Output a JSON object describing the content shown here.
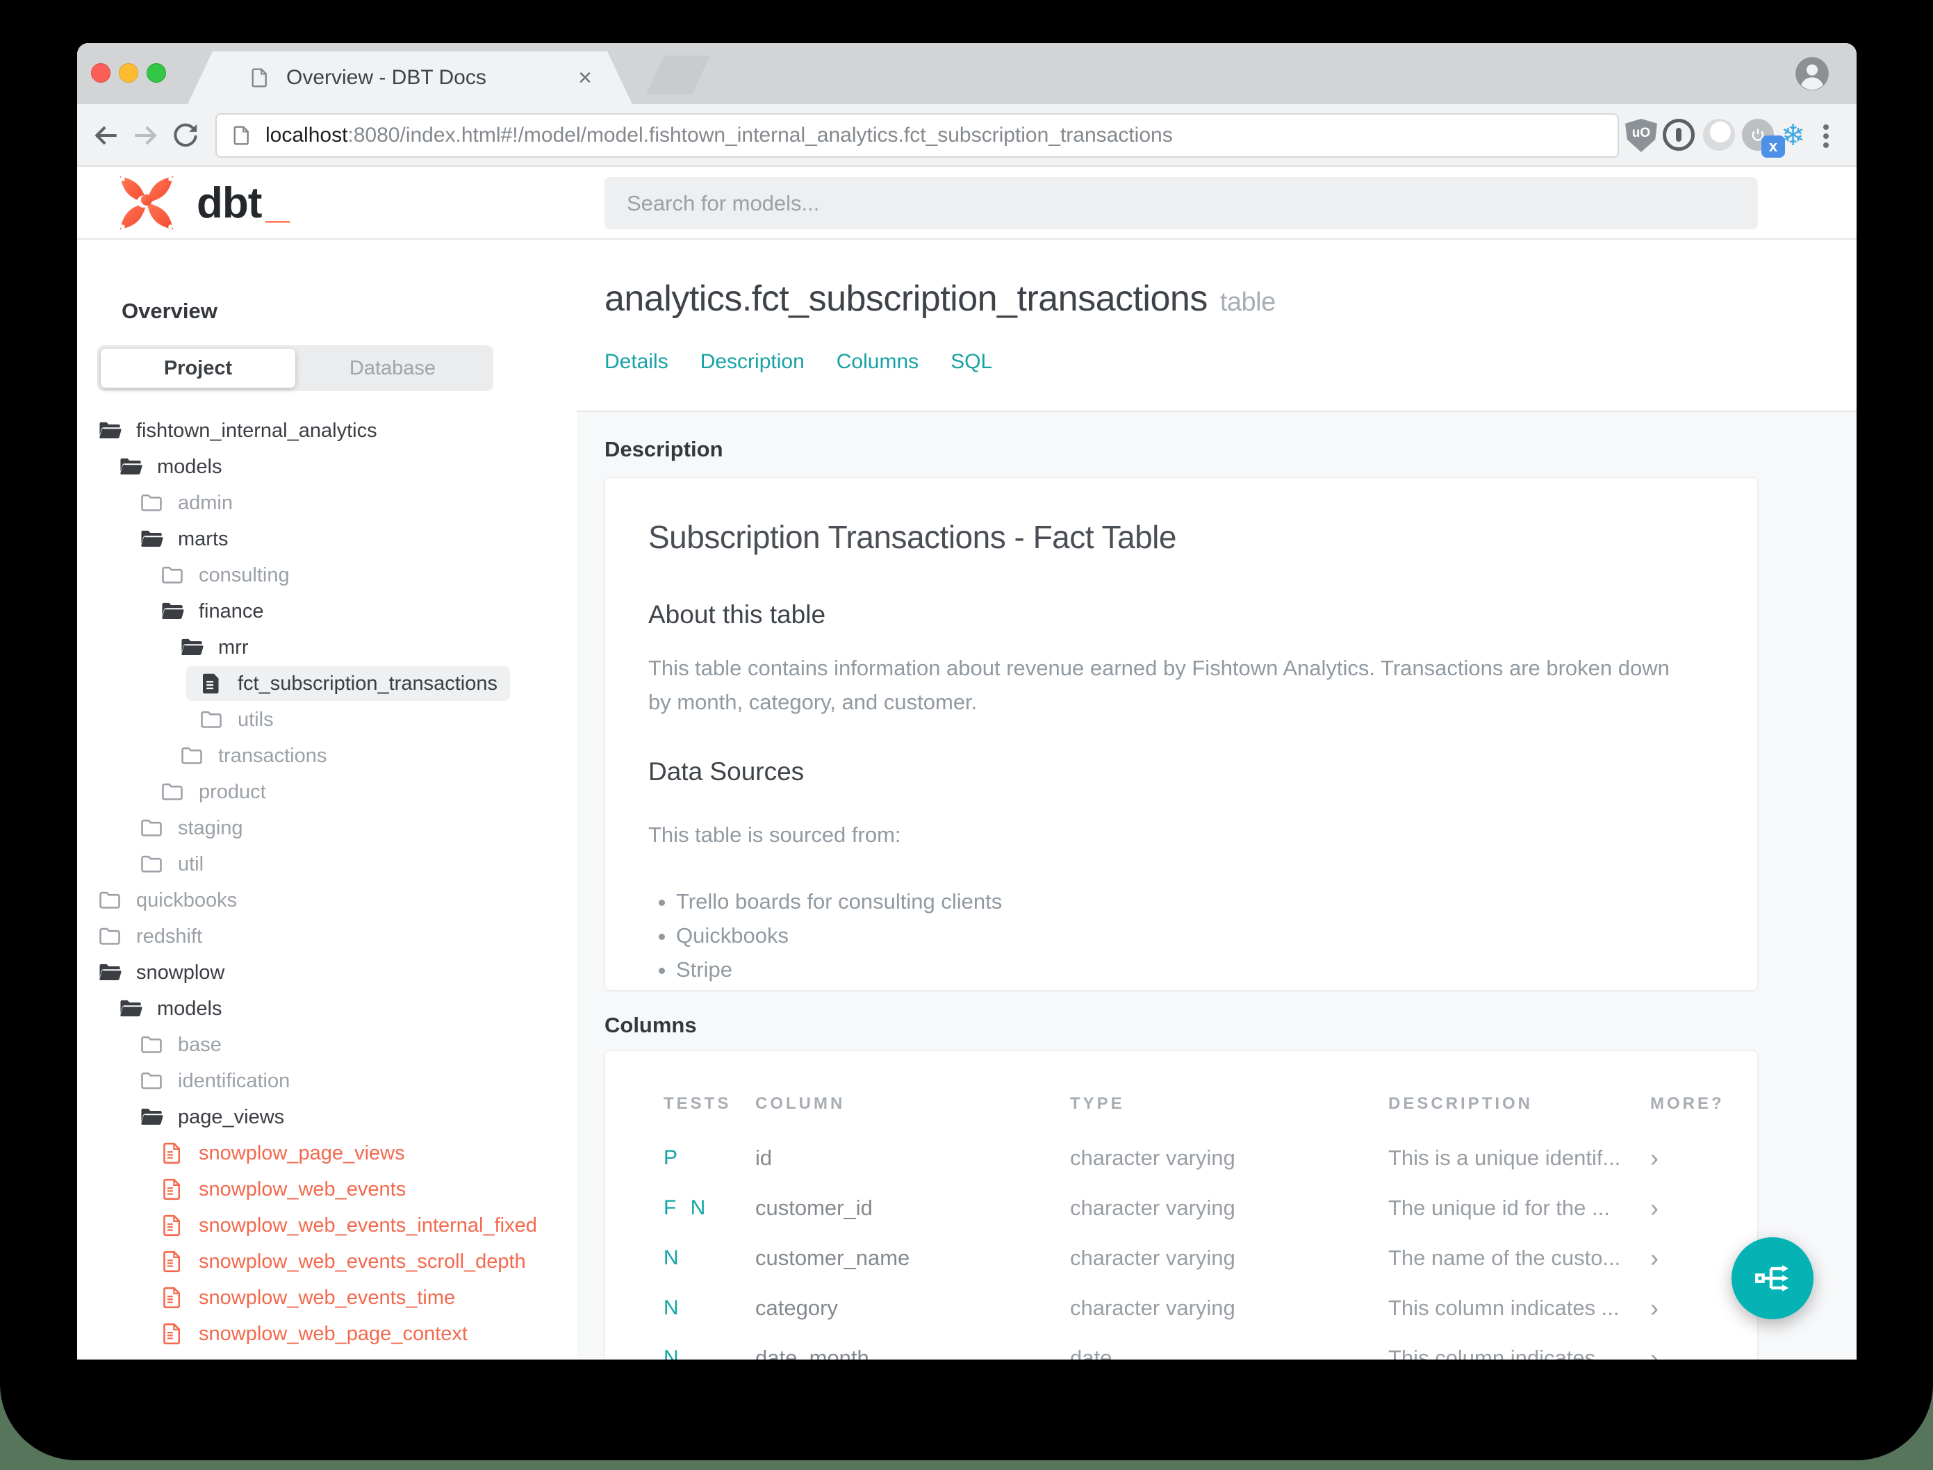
{
  "browser": {
    "tab_title": "Overview - DBT Docs",
    "tab_close": "×",
    "url_host": "localhost",
    "url_rest": ":8080/index.html#!/model/model.fishtown_internal_analytics.fct_subscription_transactions",
    "ublock_label": "uO",
    "extension_badge": "x",
    "snowflake_glyph": "❄"
  },
  "header": {
    "logo_text": "dbt",
    "logo_underscore": "_",
    "search_placeholder": "Search for models..."
  },
  "sidebar": {
    "overview_label": "Overview",
    "tabs": {
      "project": "Project",
      "database": "Database"
    },
    "tree": [
      {
        "label": "fishtown_internal_analytics",
        "level": 0,
        "icon": "folder-open",
        "tone": "dark"
      },
      {
        "label": "models",
        "level": 1,
        "icon": "folder-open",
        "tone": "dark"
      },
      {
        "label": "admin",
        "level": 2,
        "icon": "folder-closed",
        "tone": "gray"
      },
      {
        "label": "marts",
        "level": 2,
        "icon": "folder-open",
        "tone": "dark"
      },
      {
        "label": "consulting",
        "level": 3,
        "icon": "folder-closed",
        "tone": "gray"
      },
      {
        "label": "finance",
        "level": 3,
        "icon": "folder-open",
        "tone": "dark"
      },
      {
        "label": "mrr",
        "level": 4,
        "icon": "folder-open",
        "tone": "dark"
      },
      {
        "label": "fct_subscription_transactions",
        "level": 5,
        "icon": "file-dark",
        "tone": "dark",
        "selected": true
      },
      {
        "label": "utils",
        "level": 5,
        "icon": "folder-closed",
        "tone": "gray"
      },
      {
        "label": "transactions",
        "level": 4,
        "icon": "folder-closed",
        "tone": "gray"
      },
      {
        "label": "product",
        "level": 3,
        "icon": "folder-closed",
        "tone": "gray"
      },
      {
        "label": "staging",
        "level": 2,
        "icon": "folder-closed",
        "tone": "gray"
      },
      {
        "label": "util",
        "level": 2,
        "icon": "folder-closed",
        "tone": "gray"
      },
      {
        "label": "quickbooks",
        "level": 0,
        "icon": "folder-closed",
        "tone": "gray"
      },
      {
        "label": "redshift",
        "level": 0,
        "icon": "folder-closed",
        "tone": "gray"
      },
      {
        "label": "snowplow",
        "level": 0,
        "icon": "folder-open",
        "tone": "dark"
      },
      {
        "label": "models",
        "level": 1,
        "icon": "folder-open",
        "tone": "dark"
      },
      {
        "label": "base",
        "level": 2,
        "icon": "folder-closed",
        "tone": "gray"
      },
      {
        "label": "identification",
        "level": 2,
        "icon": "folder-closed",
        "tone": "gray"
      },
      {
        "label": "page_views",
        "level": 2,
        "icon": "folder-open",
        "tone": "dark"
      },
      {
        "label": "snowplow_page_views",
        "level": 3,
        "icon": "file-red",
        "tone": "red"
      },
      {
        "label": "snowplow_web_events",
        "level": 3,
        "icon": "file-red",
        "tone": "red"
      },
      {
        "label": "snowplow_web_events_internal_fixed",
        "level": 3,
        "icon": "file-red",
        "tone": "red"
      },
      {
        "label": "snowplow_web_events_scroll_depth",
        "level": 3,
        "icon": "file-red",
        "tone": "red"
      },
      {
        "label": "snowplow_web_events_time",
        "level": 3,
        "icon": "file-red",
        "tone": "red"
      },
      {
        "label": "snowplow_web_page_context",
        "level": 3,
        "icon": "file-red",
        "tone": "red"
      }
    ]
  },
  "main": {
    "title": "analytics.fct_subscription_transactions",
    "title_suffix": "table",
    "nav": [
      "Details",
      "Description",
      "Columns",
      "SQL"
    ],
    "description_section": {
      "label": "Description",
      "heading": "Subscription Transactions - Fact Table",
      "about_heading": "About this table",
      "about_text": "This table contains information about revenue earned by Fishtown Analytics. Transactions are broken down by month, category, and customer.",
      "sources_heading": "Data Sources",
      "sources_intro": "This table is sourced from:",
      "sources": [
        "Trello boards for consulting clients",
        "Quickbooks",
        "Stripe"
      ]
    },
    "columns_section": {
      "label": "Columns",
      "table_headers": [
        "TESTS",
        "COLUMN",
        "TYPE",
        "DESCRIPTION",
        "MORE?"
      ],
      "rows": [
        {
          "tests": "P",
          "column": "id",
          "type": "character varying",
          "description": "This is a unique identif...",
          "more": "›"
        },
        {
          "tests": "F N",
          "column": "customer_id",
          "type": "character varying",
          "description": "The unique id for the ...",
          "more": "›"
        },
        {
          "tests": "N",
          "column": "customer_name",
          "type": "character varying",
          "description": "The name of the custo...",
          "more": "›"
        },
        {
          "tests": "N",
          "column": "category",
          "type": "character varying",
          "description": "This column indicates ...",
          "more": "›"
        },
        {
          "tests": "N",
          "column": "date_month",
          "type": "date",
          "description": "This column indicates ...",
          "more": "›"
        }
      ]
    }
  },
  "colors": {
    "accent_teal": "#17a2a5",
    "fab_teal": "#05b2b4",
    "brand_orange": "#ff6847",
    "model_red": "#f4694d"
  }
}
